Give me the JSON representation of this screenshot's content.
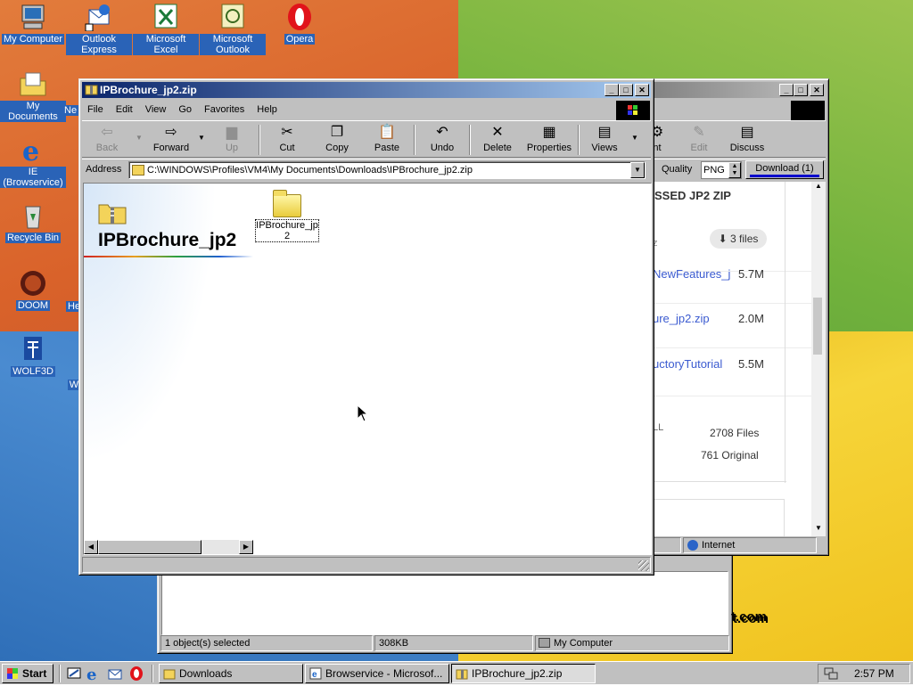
{
  "desktop": {
    "icons": [
      {
        "label": "My Computer"
      },
      {
        "label": "Outlook Express"
      },
      {
        "label": "Microsoft Excel"
      },
      {
        "label": "Microsoft Outlook"
      },
      {
        "label": "Opera"
      },
      {
        "label": "My Documents"
      },
      {
        "label": "IE (Browservice)"
      },
      {
        "label": "Recycle Bin"
      },
      {
        "label": "DOOM"
      },
      {
        "label": "WOLF3D"
      }
    ],
    "partial_labels": [
      "Ne",
      "He",
      "W"
    ]
  },
  "explorer": {
    "title": "IPBrochure_jp2.zip",
    "menu": [
      "File",
      "Edit",
      "View",
      "Go",
      "Favorites",
      "Help"
    ],
    "toolbar": {
      "back": "Back",
      "forward": "Forward",
      "up": "Up",
      "cut": "Cut",
      "copy": "Copy",
      "paste": "Paste",
      "undo": "Undo",
      "delete": "Delete",
      "properties": "Properties",
      "views": "Views"
    },
    "address_label": "Address",
    "address_value": "C:\\WINDOWS\\Profiles\\VM4\\My Documents\\Downloads\\IPBrochure_jp2.zip",
    "left_panel_title": "IPBrochure_jp2",
    "folder_item": "IPBrochure_jp2"
  },
  "browser": {
    "toolbar": {
      "nt": "nt",
      "edit": "Edit",
      "discuss": "Discuss"
    },
    "quality_label": "Quality",
    "quality_value": "PNG",
    "download_button": "Download (1)",
    "heading": "SSED JP2 ZIP",
    "files_badge": "3 files",
    "files": [
      {
        "name": "NewFeatures_j",
        "size": "5.7M"
      },
      {
        "name": "ure_jp2.zip",
        "size": "2.0M"
      },
      {
        "name": "uctoryTutorial",
        "size": "5.5M"
      }
    ],
    "ll_label": "LL",
    "total_files": "2708 Files",
    "original": "761 Original",
    "status_zone": "Internet"
  },
  "downloads_window": {
    "status_selected": "1 object(s) selected",
    "status_size": "308KB",
    "status_location": "My Computer",
    "partial_text": "t.com"
  },
  "taskbar": {
    "start": "Start",
    "items": [
      "Downloads",
      "Browservice - Microsof...",
      "IPBrochure_jp2.zip"
    ],
    "clock": "2:57 PM"
  }
}
